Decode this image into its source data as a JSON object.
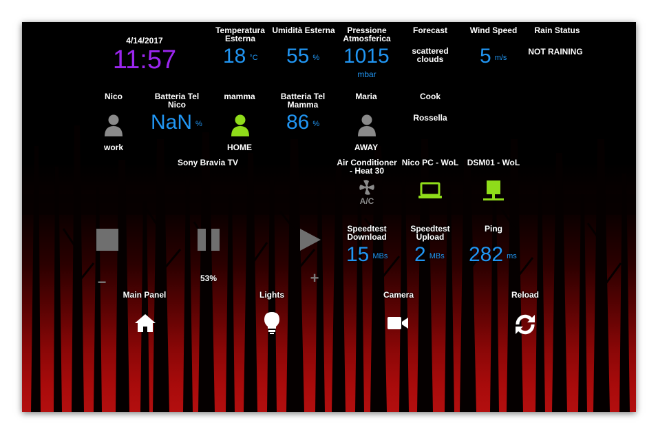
{
  "clock": {
    "date": "4/14/2017",
    "time": "11:57"
  },
  "weather": {
    "temp": {
      "label": "Temperatura Esterna",
      "value": "18",
      "unit": "°C"
    },
    "humidity": {
      "label": "Umidità Esterna",
      "value": "55",
      "unit": "%"
    },
    "pressure": {
      "label": "Pressione Atmosferica",
      "value": "1015",
      "unit": "mbar"
    },
    "forecast": {
      "label": "Forecast",
      "value": "scattered clouds"
    },
    "wind": {
      "label": "Wind Speed",
      "value": "5",
      "unit": "m/s"
    },
    "rain": {
      "label": "Rain Status",
      "value": "NOT RAINING"
    }
  },
  "people": {
    "nico": {
      "label": "Nico",
      "state": "work",
      "color": "#8a8a8a"
    },
    "mamma": {
      "label": "mamma",
      "state": "HOME",
      "color": "#8fdc1a"
    },
    "maria": {
      "label": "Maria",
      "state": "AWAY",
      "color": "#8a8a8a"
    },
    "cook": {
      "label": "Cook",
      "state": "Rossella"
    }
  },
  "battery": {
    "nico": {
      "label": "Batteria Tel Nico",
      "value": "NaN",
      "unit": "%"
    },
    "mamma": {
      "label": "Batteria Tel Mamma",
      "value": "86",
      "unit": "%"
    }
  },
  "media": {
    "label": "Sony Bravia TV",
    "volume": "53%",
    "volume_level": 0.53,
    "stop_icon": "stop-icon",
    "pause_icon": "pause-icon",
    "play_icon": "play-icon",
    "minus": "−",
    "plus": "+"
  },
  "switches": {
    "ac": {
      "label": "Air Conditioner - Heat 30",
      "icon": "ac-icon",
      "color": "#8a8a8a"
    },
    "nicopc": {
      "label": "Nico PC - WoL",
      "icon": "laptop-icon",
      "color": "#8fdc1a"
    },
    "dsm": {
      "label": "DSM01 - WoL",
      "icon": "server-icon",
      "color": "#8fdc1a"
    }
  },
  "speed": {
    "download": {
      "label": "Speedtest Download",
      "value": "15",
      "unit": "MBs"
    },
    "upload": {
      "label": "Speedtest Upload",
      "value": "2",
      "unit": "MBs"
    },
    "ping": {
      "label": "Ping",
      "value": "282",
      "unit": "ms"
    }
  },
  "nav": {
    "main": {
      "label": "Main Panel",
      "icon": "home-icon"
    },
    "lights": {
      "label": "Lights",
      "icon": "lightbulb-icon"
    },
    "camera": {
      "label": "Camera",
      "icon": "video-camera-icon"
    },
    "reload": {
      "label": "Reload",
      "icon": "refresh-icon"
    }
  },
  "colors": {
    "accent": "#2196f3",
    "clock": "#9b26ef",
    "active": "#8fdc1a",
    "inactive": "#8a8a8a"
  }
}
